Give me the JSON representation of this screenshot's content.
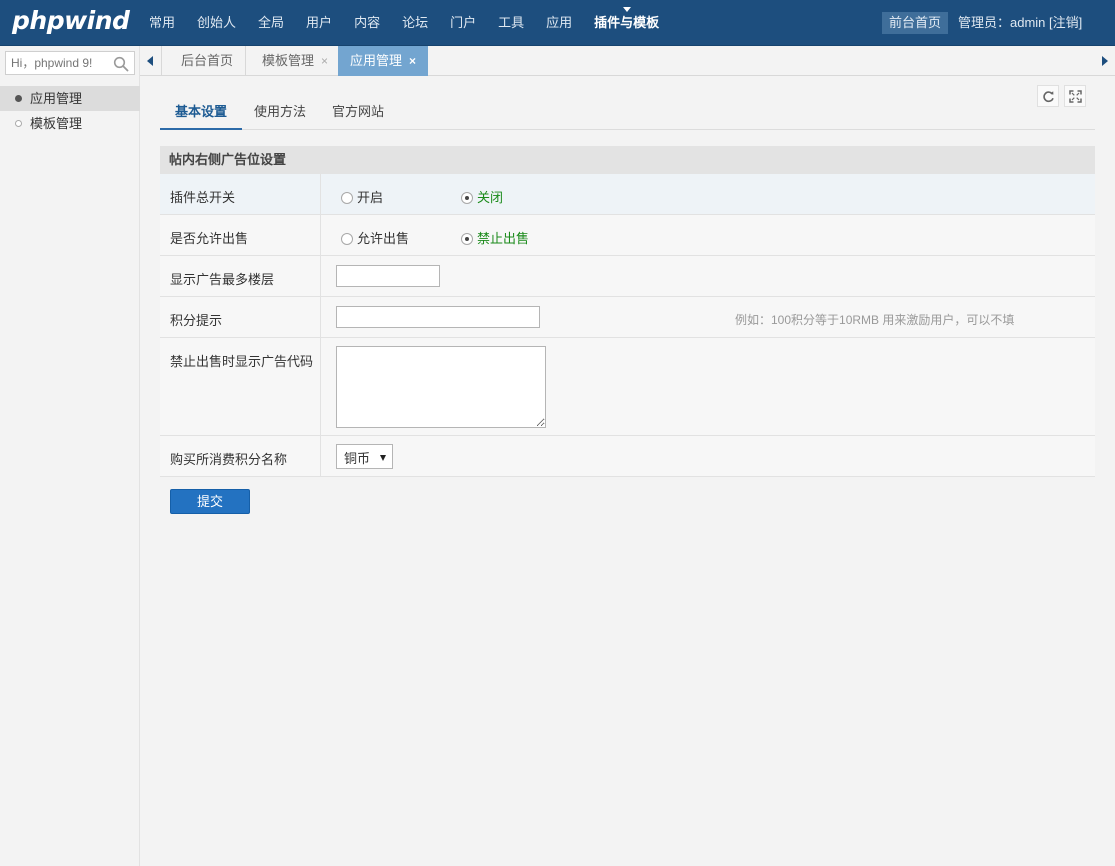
{
  "header": {
    "logo": "phpwind",
    "nav": [
      "常用",
      "创始人",
      "全局",
      "用户",
      "内容",
      "论坛",
      "门户",
      "工具",
      "应用",
      "插件与模板"
    ],
    "active_nav": "插件与模板",
    "front_home": "前台首页",
    "admin_label": "管理员：admin",
    "logout": "[注销]"
  },
  "sidebar": {
    "search_placeholder": "Hi，phpwind 9!",
    "items": [
      {
        "label": "应用管理",
        "active": true
      },
      {
        "label": "模板管理",
        "active": false
      }
    ]
  },
  "tabs": [
    {
      "label": "后台首页",
      "closable": false,
      "active": false
    },
    {
      "label": "模板管理",
      "closable": true,
      "active": false,
      "close": "×"
    },
    {
      "label": "应用管理",
      "closable": true,
      "active": true,
      "close": "×"
    }
  ],
  "sub_tabs": [
    "基本设置",
    "使用方法",
    "官方网站"
  ],
  "form": {
    "title": "帖内右侧广告位设置",
    "rows": [
      {
        "label": "插件总开关",
        "options": [
          "开启",
          "关闭"
        ],
        "selected": "关闭"
      },
      {
        "label": "是否允许出售",
        "options": [
          "允许出售",
          "禁止出售"
        ],
        "selected": "禁止出售"
      },
      {
        "label": "显示广告最多楼层",
        "value": ""
      },
      {
        "label": "积分提示",
        "value": "",
        "hint": "例如：100积分等于10RMB 用来激励用户，可以不填"
      },
      {
        "label": "禁止出售时显示广告代码",
        "value": ""
      },
      {
        "label": "购买所消费积分名称",
        "select_value": "铜币"
      }
    ],
    "submit": "提交"
  },
  "colors": {
    "topbar": "#1d4e7e",
    "active_tab": "#73a5d0",
    "checked_label": "#1a8a1a",
    "submit": "#2372c1"
  }
}
